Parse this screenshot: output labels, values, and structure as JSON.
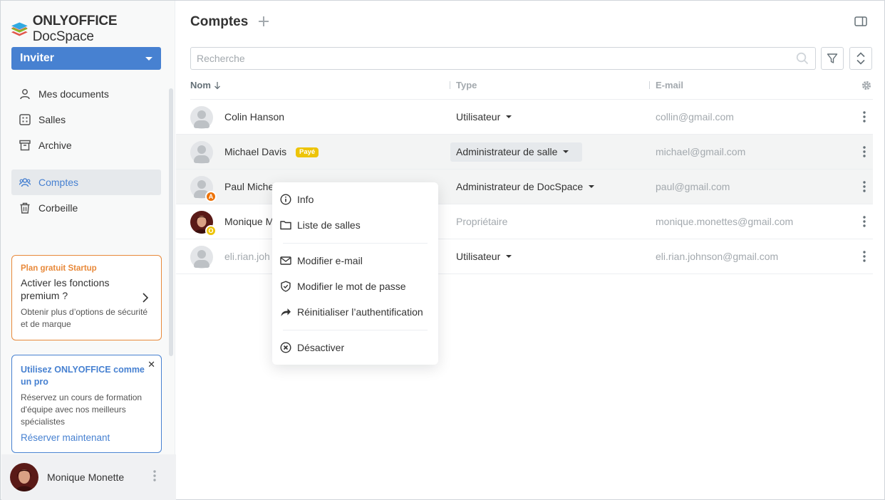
{
  "app": {
    "logo_bold": "ONLYOFFICE",
    "logo_light": "DocSpace"
  },
  "sidebar": {
    "invite_label": "Inviter",
    "items": [
      {
        "label": "Mes documents",
        "icon": "user-icon"
      },
      {
        "label": "Salles",
        "icon": "rooms-grid-icon"
      },
      {
        "label": "Archive",
        "icon": "archive-box-icon"
      },
      {
        "label": "Comptes",
        "icon": "accounts-icon",
        "active": true
      },
      {
        "label": "Corbeille",
        "icon": "trash-icon"
      }
    ],
    "plan_card": {
      "tag": "Plan gratuit Startup",
      "headline": "Activer les fonctions premium ?",
      "desc": "Obtenir plus d’options de sécurité et de marque"
    },
    "pro_card": {
      "title": "Utilisez ONLYOFFICE comme un pro",
      "desc": "Réservez un cours de formation d'équipe avec nos meilleurs spécialistes",
      "link": "Réserver maintenant"
    },
    "user": {
      "name": "Monique Monette"
    }
  },
  "header": {
    "title": "Comptes"
  },
  "search": {
    "placeholder": "Recherche"
  },
  "table": {
    "columns": {
      "name": "Nom",
      "type": "Type",
      "email": "E-mail"
    },
    "rows": [
      {
        "name": "Colin Hanson",
        "type": "Utilisateur",
        "email": "collin@gmail.com"
      },
      {
        "name": "Michael Davis",
        "badge": "Payé",
        "type": "Administrateur de salle",
        "email": "michael@gmail.com"
      },
      {
        "name": "Paul Miche",
        "avatar_badge": "A",
        "type": "Administrateur de DocSpace",
        "email": "paul@gmail.com"
      },
      {
        "name": "Monique M",
        "avatar_badge": "O",
        "type": "Propriétaire",
        "email": "monique.monettes@gmail.com"
      },
      {
        "name": "eli.rian.joh",
        "type": "Utilisateur",
        "email": "eli.rian.johnson@gmail.com"
      }
    ]
  },
  "context_menu": {
    "items": [
      {
        "label": "Info",
        "icon": "info-icon"
      },
      {
        "label": "Liste de salles",
        "icon": "folder-icon"
      },
      {
        "label": "Modifier e-mail",
        "icon": "mail-icon"
      },
      {
        "label": "Modifier le mot de passe",
        "icon": "shield-icon"
      },
      {
        "label": "Réinitialiser l’authentification",
        "icon": "share-arrow-icon"
      },
      {
        "label": "Désactiver",
        "icon": "deactivate-circle-icon"
      }
    ]
  },
  "colors": {
    "accent": "#4781d1",
    "orange": "#e8893a",
    "paid": "#edc409",
    "admin_badge": "#ed7309",
    "owner_badge": "#edc409"
  }
}
